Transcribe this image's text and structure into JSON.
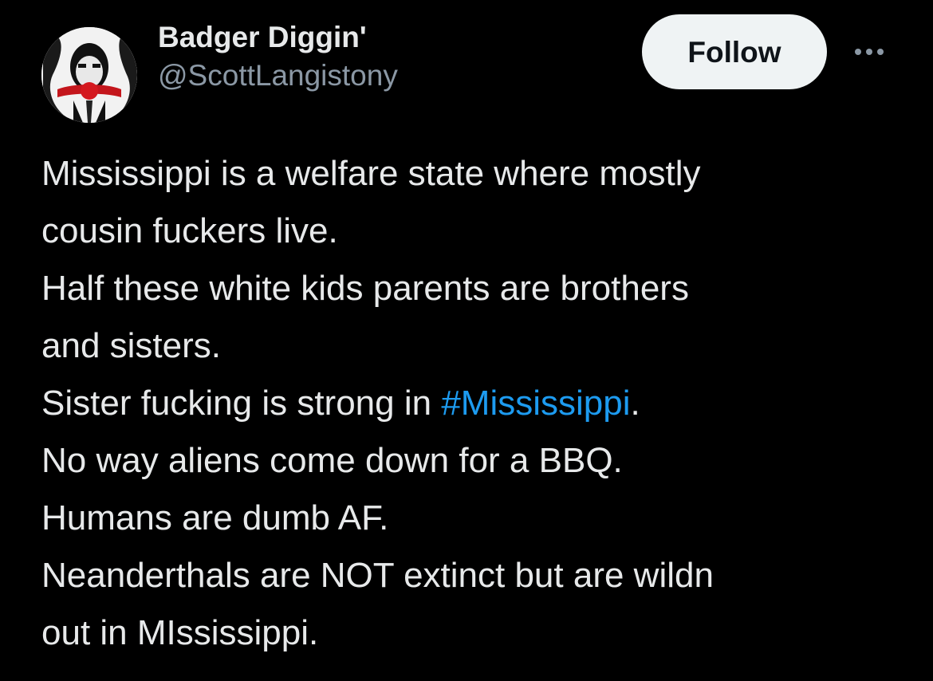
{
  "author": {
    "display_name": "Badger Diggin'",
    "handle": "@ScottLangistony"
  },
  "actions": {
    "follow_label": "Follow",
    "more_icon": "more-dots-icon"
  },
  "tweet": {
    "lines": [
      {
        "text": "Mississippi is a welfare state where mostly"
      },
      {
        "text": "cousin fuckers live."
      },
      {
        "text": "Half these white kids parents are brothers"
      },
      {
        "text": "and sisters."
      },
      {
        "before": "Sister fucking is strong in ",
        "hashtag": "#Mississippi",
        "after": "."
      },
      {
        "text": "No way aliens come down for a BBQ."
      },
      {
        "text": "Humans are dumb AF."
      },
      {
        "text": "Neanderthals are NOT extinct but are wildn"
      },
      {
        "text": "out in MIssissippi."
      }
    ]
  },
  "colors": {
    "background": "#000000",
    "text_primary": "#e7e9ea",
    "text_secondary": "#8b98a5",
    "hashtag": "#1d9bf0",
    "follow_button_bg": "#eff3f4",
    "follow_button_text": "#0f1419"
  }
}
